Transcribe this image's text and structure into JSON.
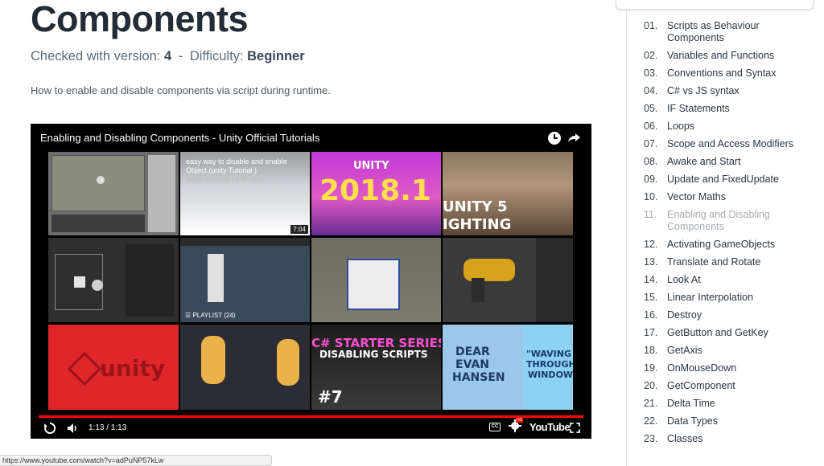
{
  "page": {
    "title": "Components",
    "meta_prefix": "Checked with version:",
    "version": "4",
    "separator": "-",
    "difficulty_prefix": "Difficulty:",
    "difficulty": "Beginner",
    "description": "How to enable and disable components via script during runtime."
  },
  "player": {
    "title": "Enabling and Disabling Components - Unity Official Tutorials",
    "tile_2_caption": "easy way to disable and enable Object (unity Tutorial )",
    "tile_2_sub": "Toufik creativity • 17K views",
    "tile_2_duration": "7:04",
    "tile_3_brand": "UNITY",
    "tile_3_version": "2018.1",
    "tile_4_line1": "UNITY 5",
    "tile_4_line2": "IGHTING",
    "playlist_label": "PLAYLIST (24)",
    "tile_9_brand": "unity",
    "tile_11_line1": "C# STARTER SERIES",
    "tile_11_line2": "DISABLING SCRIPTS",
    "tile_11_number": "#7",
    "tile_12_line1": "DEAR",
    "tile_12_line2": "EVAN",
    "tile_12_line3": "HANSEN",
    "tile_12_right1": "\"WAVING",
    "tile_12_right2": "THROUGH",
    "tile_12_right3": "WINDOW",
    "time": "1:13 / 1:13",
    "progress": 1.0,
    "cc_label": "CC",
    "hd_label": "HD",
    "logo": "YouTube"
  },
  "status_bar": {
    "url": "https://www.youtube.com/watch?v=adPuNP57kLw"
  },
  "sidebar": {
    "lessons": [
      {
        "num": "01.",
        "label": "Scripts as Behaviour Components"
      },
      {
        "num": "02.",
        "label": "Variables and Functions"
      },
      {
        "num": "03.",
        "label": "Conventions and Syntax"
      },
      {
        "num": "04.",
        "label": "C# vs JS syntax"
      },
      {
        "num": "05.",
        "label": "IF Statements"
      },
      {
        "num": "06.",
        "label": "Loops"
      },
      {
        "num": "07.",
        "label": "Scope and Access Modifiers"
      },
      {
        "num": "08.",
        "label": "Awake and Start"
      },
      {
        "num": "09.",
        "label": "Update and FixedUpdate"
      },
      {
        "num": "10.",
        "label": "Vector Maths"
      },
      {
        "num": "11.",
        "label": "Enabling and Disabling Components"
      },
      {
        "num": "12.",
        "label": "Activating GameObjects"
      },
      {
        "num": "13.",
        "label": "Translate and Rotate"
      },
      {
        "num": "14.",
        "label": "Look At"
      },
      {
        "num": "15.",
        "label": "Linear Interpolation"
      },
      {
        "num": "16.",
        "label": "Destroy"
      },
      {
        "num": "17.",
        "label": "GetButton and GetKey"
      },
      {
        "num": "18.",
        "label": "GetAxis"
      },
      {
        "num": "19.",
        "label": "OnMouseDown"
      },
      {
        "num": "20.",
        "label": "GetComponent"
      },
      {
        "num": "21.",
        "label": "Delta Time"
      },
      {
        "num": "22.",
        "label": "Data Types"
      },
      {
        "num": "23.",
        "label": "Classes"
      }
    ],
    "current_index": 10
  },
  "colors": {
    "title": "#222c37",
    "progress": "#ff0000",
    "current_lesson": "#a8adb2",
    "unity_red": "#e0262a"
  },
  "icons": {
    "clock": "clock-icon",
    "share": "share-arrow-icon",
    "replay": "replay-icon",
    "volume": "volume-icon",
    "captions": "captions-icon",
    "settings": "settings-gear-icon",
    "fullscreen": "fullscreen-icon"
  }
}
